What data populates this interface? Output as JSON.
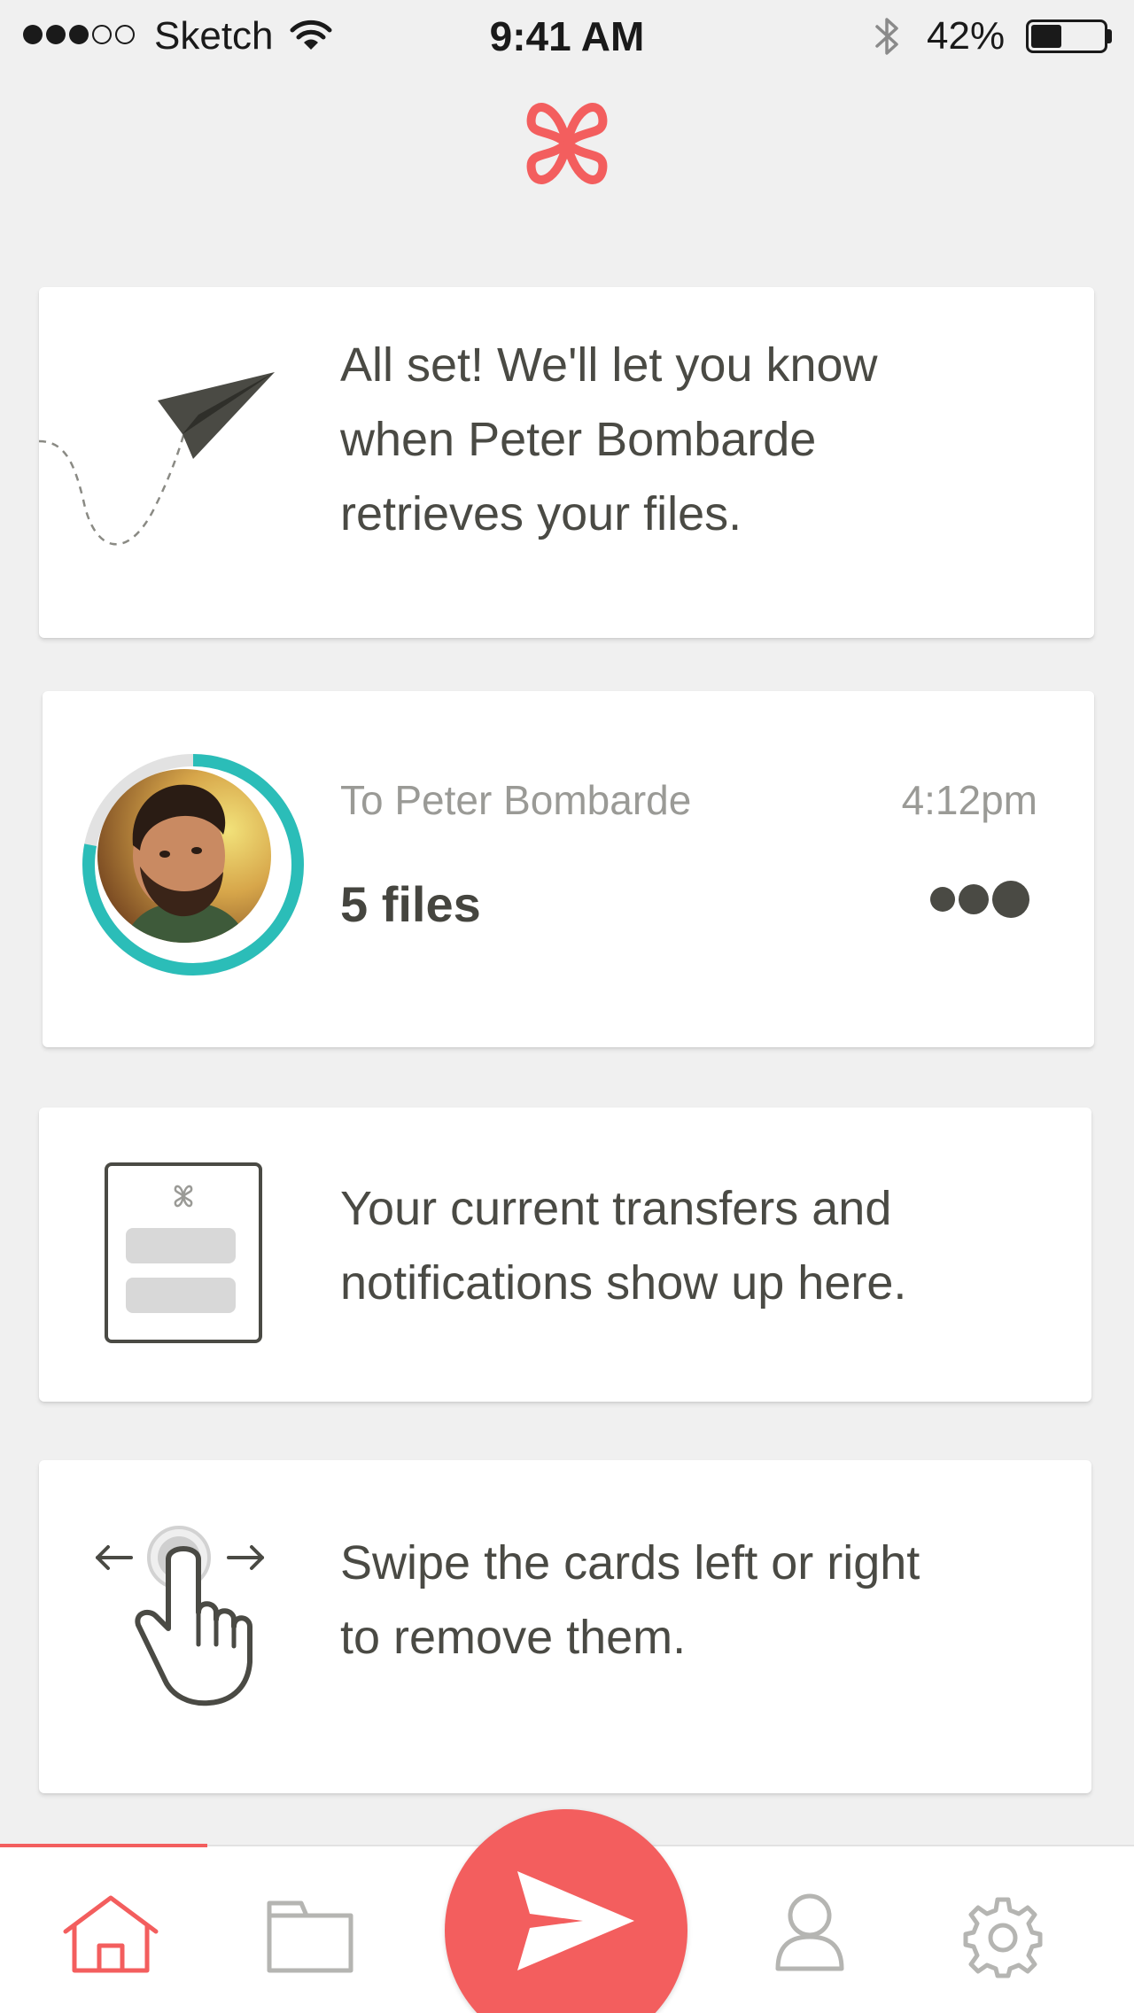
{
  "status_bar": {
    "carrier": "Sketch",
    "time": "9:41 AM",
    "battery_percent": "42%",
    "battery_level": 0.42,
    "signal_bars_filled": 3,
    "signal_bars_total": 5,
    "icons": [
      "wifi-icon",
      "bluetooth-icon",
      "battery-icon"
    ]
  },
  "header": {
    "logo_icon": "bowtie-logo-icon"
  },
  "cards": {
    "sent_confirmation": {
      "icon": "paper-plane-icon",
      "line1": "All set! We'll let you know",
      "line2": "when Peter Bombarde",
      "line3": "retrieves your files."
    },
    "transfer": {
      "icon": "avatar-progress-ring",
      "recipient": "To Peter Bombarde",
      "time": "4:12pm",
      "files": "5 files",
      "progress": 0.78,
      "status_icon": "loading-dots-icon"
    },
    "info": {
      "icon": "phone-cards-icon",
      "line1": "Your current transfers and",
      "line2": "notifications show up here."
    },
    "swipe_hint": {
      "icon": "swipe-hand-icon",
      "line1": "Swipe the cards left or right",
      "line2": "to remove them."
    }
  },
  "bottom_nav": {
    "items": [
      {
        "name": "home",
        "icon": "home-icon",
        "active": true
      },
      {
        "name": "files",
        "icon": "folder-icon",
        "active": false
      },
      {
        "name": "send",
        "icon": "send-icon",
        "active": false
      },
      {
        "name": "contacts",
        "icon": "person-icon",
        "active": false
      },
      {
        "name": "settings",
        "icon": "gear-icon",
        "active": false
      }
    ]
  },
  "colors": {
    "accent": "#f35e5e",
    "progress": "#2bbdb8",
    "text_dark": "#4a4a44",
    "text_muted": "#9a9a96",
    "background": "#f0f0f0",
    "card": "#ffffff"
  }
}
